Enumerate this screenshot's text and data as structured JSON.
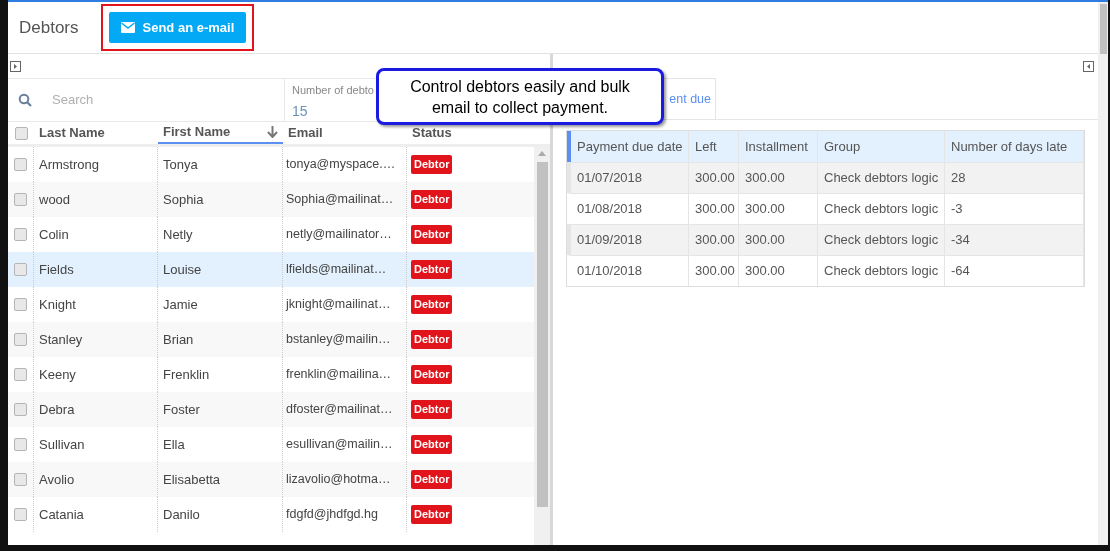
{
  "header": {
    "title": "Debtors",
    "send_button": "Send an e-mail"
  },
  "left_panel": {
    "search": {
      "placeholder": "Search"
    },
    "count": {
      "label": "Number of debto",
      "value": "15"
    },
    "columns": [
      {
        "label": "Last Name",
        "sorted": false
      },
      {
        "label": "First Name",
        "sorted": true
      },
      {
        "label": "Email",
        "sorted": false
      },
      {
        "label": "Status",
        "sorted": false
      }
    ],
    "select_all": {
      "checked": false
    },
    "rows": [
      {
        "last": "Armstrong",
        "first": "Tonya",
        "email": "tonya@myspace.…",
        "status": "Debtor",
        "checked": false,
        "selected": false
      },
      {
        "last": "wood",
        "first": "Sophia",
        "email": "Sophia@mailinat…",
        "status": "Debtor",
        "checked": false,
        "selected": false
      },
      {
        "last": "Colin",
        "first": "Netly",
        "email": "netly@mailinator…",
        "status": "Debtor",
        "checked": false,
        "selected": false
      },
      {
        "last": "Fields",
        "first": "Louise",
        "email": "lfields@mailinat…",
        "status": "Debtor",
        "checked": false,
        "selected": true
      },
      {
        "last": "Knight",
        "first": "Jamie",
        "email": "jknight@mailinat…",
        "status": "Debtor",
        "checked": false,
        "selected": false
      },
      {
        "last": "Stanley",
        "first": "Brian",
        "email": "bstanley@mailin…",
        "status": "Debtor",
        "checked": false,
        "selected": false
      },
      {
        "last": "Keeny",
        "first": "Frenklin",
        "email": "frenklin@mailina…",
        "status": "Debtor",
        "checked": false,
        "selected": false
      },
      {
        "last": "Debra",
        "first": "Foster",
        "email": "dfoster@mailinat…",
        "status": "Debtor",
        "checked": false,
        "selected": false
      },
      {
        "last": "Sullivan",
        "first": "Ella",
        "email": "esullivan@mailin…",
        "status": "Debtor",
        "checked": false,
        "selected": false
      },
      {
        "last": "Avolio",
        "first": "Elisabetta",
        "email": "lizavolio@hotma…",
        "status": "Debtor",
        "checked": false,
        "selected": false
      },
      {
        "last": "Catania",
        "first": "Danilo",
        "email": "fdgfd@jhdfgd.hg",
        "status": "Debtor",
        "checked": false,
        "selected": false
      }
    ]
  },
  "right_panel": {
    "tabs": [
      {
        "label": "ent due",
        "selected": true
      }
    ],
    "columns": [
      "Payment due date",
      "Left",
      "Installment",
      "Group",
      "Number of days late"
    ],
    "rows": [
      [
        "01/07/2018",
        "300.00",
        "300.00",
        "Check debtors logic",
        "28"
      ],
      [
        "01/08/2018",
        "300.00",
        "300.00",
        "Check debtors logic",
        "-3"
      ],
      [
        "01/09/2018",
        "300.00",
        "300.00",
        "Check debtors logic",
        "-34"
      ],
      [
        "01/10/2018",
        "300.00",
        "300.00",
        "Check debtors logic",
        "-64"
      ]
    ]
  },
  "callout": {
    "text": "Control debtors easily and bulk email to collect payment."
  }
}
